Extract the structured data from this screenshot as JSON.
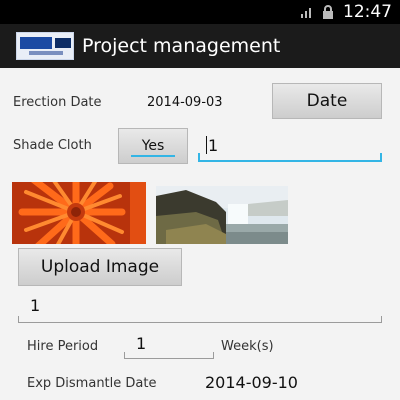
{
  "status_bar": {
    "time": "12:47",
    "icons": [
      "signal-icon",
      "lock-icon"
    ]
  },
  "action_bar": {
    "title": "Project management",
    "logo_icon": "app-logo-icon"
  },
  "form": {
    "erection_label": "Erection Date",
    "erection_value": "2014-09-03",
    "date_button": "Date",
    "shade_label": "Shade Cloth",
    "shade_toggle": "Yes",
    "shade_qty": "1",
    "images": [
      "flower-photo",
      "waterfall-photo"
    ],
    "upload_button": "Upload Image",
    "description_value": "1",
    "hire_label": "Hire Period",
    "hire_value": "1",
    "hire_unit": "Week(s)",
    "dismantle_label": "Exp Dismantle Date",
    "dismantle_value": "2014-09-10"
  },
  "colors": {
    "accent": "#33b5e5",
    "action_bar": "#1b1b1b",
    "background": "#f3f3f3"
  }
}
